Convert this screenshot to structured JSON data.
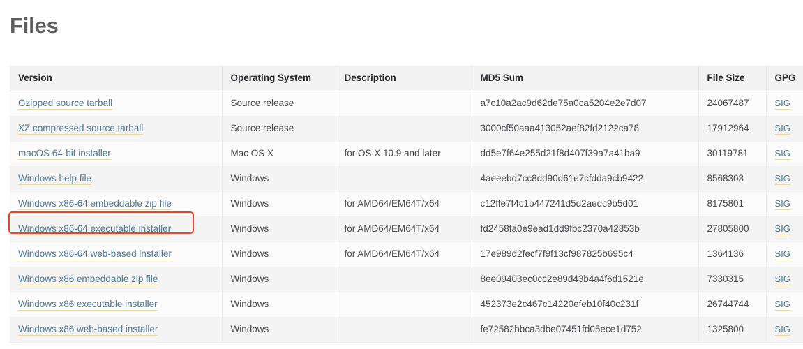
{
  "page": {
    "title": "Files"
  },
  "table": {
    "columns": [
      {
        "key": "version",
        "label": "Version"
      },
      {
        "key": "os",
        "label": "Operating System"
      },
      {
        "key": "description",
        "label": "Description"
      },
      {
        "key": "md5",
        "label": "MD5 Sum"
      },
      {
        "key": "size",
        "label": "File Size"
      },
      {
        "key": "gpg",
        "label": "GPG"
      }
    ],
    "gpg_link_label": "SIG",
    "rows": [
      {
        "version": "Gzipped source tarball",
        "os": "Source release",
        "description": "",
        "md5": "a7c10a2ac9d62de75a0ca5204e2e7d07",
        "size": "24067487",
        "gpg": "SIG"
      },
      {
        "version": "XZ compressed source tarball",
        "os": "Source release",
        "description": "",
        "md5": "3000cf50aaa413052aef82fd2122ca78",
        "size": "17912964",
        "gpg": "SIG"
      },
      {
        "version": "macOS 64-bit installer",
        "os": "Mac OS X",
        "description": "for OS X 10.9 and later",
        "md5": "dd5e7f64e255d21f8d407f39a7a41ba9",
        "size": "30119781",
        "gpg": "SIG"
      },
      {
        "version": "Windows help file",
        "os": "Windows",
        "description": "",
        "md5": "4aeeebd7cc8dd90d61e7cfdda9cb9422",
        "size": "8568303",
        "gpg": "SIG"
      },
      {
        "version": "Windows x86-64 embeddable zip file",
        "os": "Windows",
        "description": "for AMD64/EM64T/x64",
        "md5": "c12ffe7f4c1b447241d5d2aedc9b5d01",
        "size": "8175801",
        "gpg": "SIG"
      },
      {
        "version": "Windows x86-64 executable installer",
        "os": "Windows",
        "description": "for AMD64/EM64T/x64",
        "md5": "fd2458fa0e9ead1dd9fbc2370a42853b",
        "size": "27805800",
        "gpg": "SIG"
      },
      {
        "version": "Windows x86-64 web-based installer",
        "os": "Windows",
        "description": "for AMD64/EM64T/x64",
        "md5": "17e989d2fecf7f9f13cf987825b695c4",
        "size": "1364136",
        "gpg": "SIG"
      },
      {
        "version": "Windows x86 embeddable zip file",
        "os": "Windows",
        "description": "",
        "md5": "8ee09403ec0cc2e89d43b4a4f6d1521e",
        "size": "7330315",
        "gpg": "SIG"
      },
      {
        "version": "Windows x86 executable installer",
        "os": "Windows",
        "description": "",
        "md5": "452373e2c467c14220efeb10f40c231f",
        "size": "26744744",
        "gpg": "SIG"
      },
      {
        "version": "Windows x86 web-based installer",
        "os": "Windows",
        "description": "",
        "md5": "fe72582bbca3dbe07451fd05ece1d752",
        "size": "1325800",
        "gpg": "SIG"
      }
    ]
  },
  "annotation": {
    "target_row_index": 5,
    "target_label": "Windows x86-64 executable installer",
    "color": "#e8442a"
  },
  "colors": {
    "link": "#4f7a99",
    "link_underline": "#e7d8a6",
    "header_bg": "#f2f2f2",
    "row_odd_bg": "#fbfbfb",
    "row_even_bg": "#f4f4f4",
    "title": "#5e5e5e",
    "annotation": "#e8442a"
  }
}
